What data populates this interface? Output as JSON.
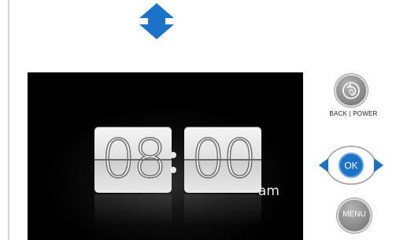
{
  "clock": {
    "hours": "08",
    "minutes": "00",
    "period": "am"
  },
  "controls": {
    "back_label": "BACK | POWER",
    "ok_label": "OK",
    "menu_label": "MENU"
  },
  "icons": {
    "scroll": "up-down-arrow-icon",
    "back": "back-power-icon",
    "left": "arrow-left-icon",
    "right": "arrow-right-icon"
  },
  "colors": {
    "accent_blue": "#1a73c8",
    "screen_bg": "#000000",
    "button_gray": "#8e8e8e"
  }
}
